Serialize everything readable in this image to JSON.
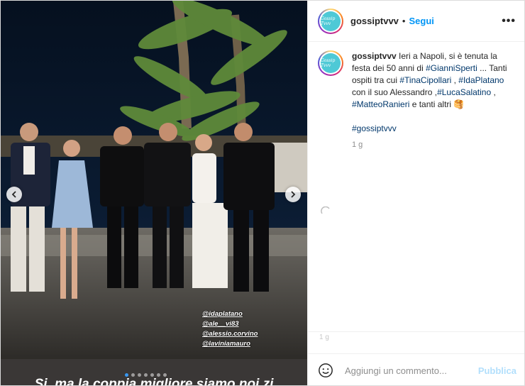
{
  "post": {
    "username": "gossiptvvv",
    "header_separator": "•",
    "follow_label": "Segui",
    "more_label": "•••",
    "avatar_text": "Gossip Tvvv",
    "caption": {
      "line1": "Ieri a Napoli, si è tenuta la festa dei 50 anni di ",
      "tag_gianni": "#GianniSperti",
      "line2": " ... Tanti ospiti tra cui ",
      "tag_tina": "#TinaCipollari",
      "line3": " , ",
      "tag_ida": "#IdaPlatano",
      "line4": " con il suo Alessandro ,",
      "tag_luca": "#LucaSalatino",
      "line5": " , ",
      "tag_matteo": "#MatteoRanieri",
      "line6": " e tanti altri ",
      "emoji": "🥞",
      "hashtag_extra": "#gossiptvvv"
    },
    "time_ago": "1 g",
    "footer_time": "1 g",
    "media": {
      "overlay_text": "Si, ma la coppia migliore siamo noi zi",
      "tags": [
        "@idaplatano",
        "@ale__vi83",
        "@alessio.corvino",
        "@laviniamauro"
      ],
      "dots_total": 7,
      "dots_active_index": 0
    },
    "add_comment": {
      "placeholder": "Aggiungi un commento...",
      "publish_label": "Pubblica"
    },
    "colors": {
      "link": "#0095f6",
      "hashtag": "#00376b",
      "publish_disabled": "#b2dffc"
    }
  }
}
